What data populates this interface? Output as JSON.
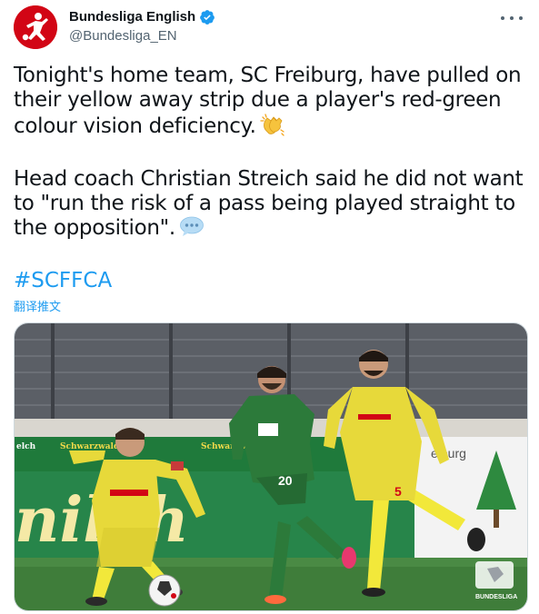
{
  "tweet": {
    "author": {
      "name": "Bundesliga English",
      "handle": "@Bundesliga_EN",
      "avatar_icon": "bundesliga-logo-icon",
      "verified_icon": "verified-badge-icon"
    },
    "text_paragraph_1": "Tonight's home team, SC Freiburg, have pulled on their yellow away strip due a player's red-green colour vision deficiency.",
    "emoji_1": "clapping-hands-icon",
    "text_paragraph_2": "Head coach Christian Streich said he did not want to \"run the risk of a pass being played straight to the opposition\".",
    "emoji_2": "speech-balloon-icon",
    "hashtag": "#SCFFCA",
    "translate_label": "翻译推文",
    "more_icon": "more-options-icon",
    "media": {
      "description_icon": "match-photo",
      "ad_boards": [
        "elch",
        "Schwarzwald",
        "Schwarzwaldmilch",
        "nilch",
        "eiburg"
      ],
      "shirt_numbers": [
        "20",
        "5"
      ],
      "watermark": "BUNDESLIGA"
    }
  },
  "colors": {
    "accent": "#1d9bf0",
    "brand_red": "#d20515",
    "freiburg_yellow": "#f2e83a",
    "augsburg_green": "#2c7a3a"
  }
}
